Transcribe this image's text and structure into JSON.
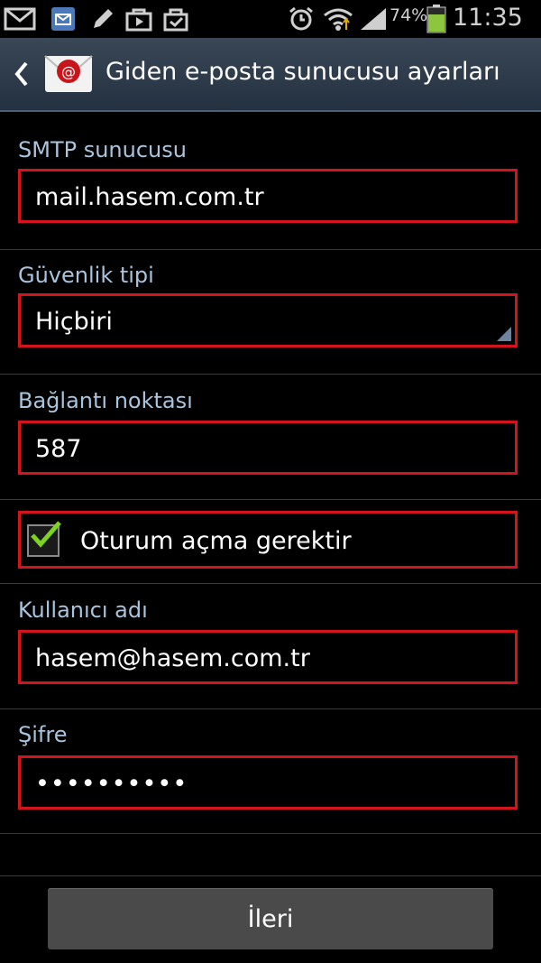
{
  "status_bar": {
    "battery_percent": "74%",
    "time": "11:35",
    "battery_level": 0.74,
    "icons": [
      "gmail-icon",
      "email-icon",
      "pencil-icon",
      "play-store-icon",
      "shopping-bag-icon",
      "alarm-icon",
      "wifi-icon",
      "signal-icon",
      "battery-icon"
    ]
  },
  "action_bar": {
    "title": "Giden e-posta sunucusu ayarları",
    "icons": [
      "back-icon",
      "email-app-icon"
    ]
  },
  "form": {
    "smtp_server": {
      "label": "SMTP sunucusu",
      "value": "mail.hasem.com.tr"
    },
    "security_type": {
      "label": "Güvenlik tipi",
      "value": "Hiçbiri"
    },
    "port": {
      "label": "Bağlantı noktası",
      "value": "587"
    },
    "require_signin": {
      "label": "Oturum açma gerektir",
      "checked": true
    },
    "username": {
      "label": "Kullanıcı adı",
      "value": "hasem@hasem.com.tr"
    },
    "password": {
      "label": "Şifre",
      "value": "••••••••••"
    }
  },
  "next_button": {
    "label": "İleri"
  },
  "colors": {
    "highlight": "#d4141c",
    "label": "#a9c4dc",
    "check": "#7ed321",
    "action_bar": "#2e3b4a"
  }
}
